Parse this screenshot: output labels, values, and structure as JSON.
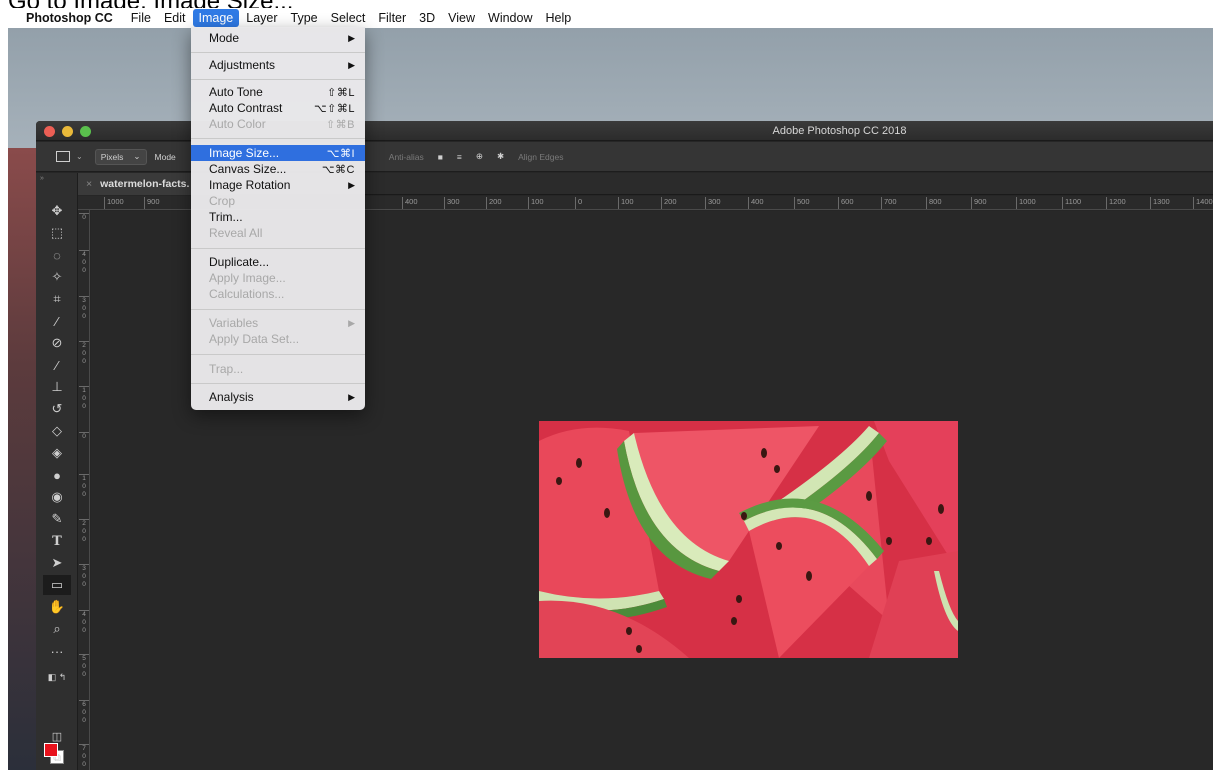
{
  "caption": "Go to Image, Image Size...",
  "menubar": {
    "app": "Photoshop CC",
    "items": [
      "File",
      "Edit",
      "Image",
      "Layer",
      "Type",
      "Select",
      "Filter",
      "3D",
      "View",
      "Window",
      "Help"
    ],
    "active": "Image"
  },
  "window": {
    "title": "Adobe Photoshop CC 2018"
  },
  "options_bar": {
    "units": "Pixels",
    "mode_label": "Mode",
    "anti_alias": "Anti-alias",
    "align_edges": "Align Edges"
  },
  "document": {
    "tab_name": "watermelon-facts.",
    "close": "×"
  },
  "ruler_top": [
    "1000",
    "900",
    "400",
    "300",
    "200",
    "100",
    "0",
    "100",
    "200",
    "300",
    "400",
    "500",
    "600",
    "700",
    "800",
    "900",
    "1000",
    "1100",
    "1200",
    "1300",
    "1400",
    "1"
  ],
  "ruler_left": [
    "0",
    "4\n0\n0",
    "3\n0\n0",
    "2\n0\n0",
    "1\n0\n0",
    "0",
    "1\n0\n0",
    "2\n0\n0",
    "3\n0\n0",
    "4\n0\n0",
    "5\n0\n0",
    "6\n0\n0",
    "7\n0\n0"
  ],
  "menu": {
    "mode": "Mode",
    "adjustments": "Adjustments",
    "auto_tone": "Auto Tone",
    "auto_tone_sc": "⇧⌘L",
    "auto_contrast": "Auto Contrast",
    "auto_contrast_sc": "⌥⇧⌘L",
    "auto_color": "Auto Color",
    "auto_color_sc": "⇧⌘B",
    "image_size": "Image Size...",
    "image_size_sc": "⌥⌘I",
    "canvas_size": "Canvas Size...",
    "canvas_size_sc": "⌥⌘C",
    "image_rotation": "Image Rotation",
    "crop": "Crop",
    "trim": "Trim...",
    "reveal_all": "Reveal All",
    "duplicate": "Duplicate...",
    "apply_image": "Apply Image...",
    "calculations": "Calculations...",
    "variables": "Variables",
    "apply_data_set": "Apply Data Set...",
    "trap": "Trap...",
    "analysis": "Analysis",
    "submenu_arrow": "▶"
  },
  "colors": {
    "menu_highlight": "#2f6fdf",
    "foreground_swatch": "#e8121c",
    "background_swatch": "#ffffff"
  },
  "tools": [
    "move-tool-icon",
    "marquee-tool-icon",
    "lasso-tool-icon",
    "magic-wand-icon",
    "crop-tool-icon",
    "eyedropper-icon",
    "healing-brush-icon",
    "brush-tool-icon",
    "clone-stamp-icon",
    "history-brush-icon",
    "eraser-icon",
    "paint-bucket-icon",
    "blur-tool-icon",
    "dodge-tool-icon",
    "pen-tool-icon",
    "type-tool-icon",
    "path-selection-icon",
    "rectangle-tool-icon",
    "hand-tool-icon",
    "zoom-tool-icon",
    "more-tools-icon"
  ]
}
